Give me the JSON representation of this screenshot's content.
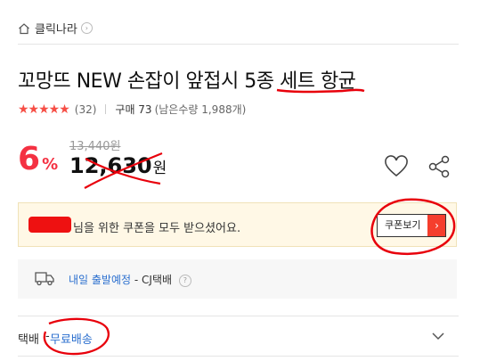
{
  "store": {
    "name": "클릭나라",
    "chevron": "›"
  },
  "product": {
    "title": "꼬망뜨 NEW 손잡이 앞접시 5종 세트 항균",
    "rating": {
      "stars": "★★★★★",
      "count": "(32)"
    },
    "purchase": "구매 73",
    "remaining": "(남은수량 1,988개)"
  },
  "price": {
    "discount_value": "6",
    "discount_unit": "%",
    "original": "13,440원",
    "current": "12,630",
    "currency": "원"
  },
  "coupon": {
    "message": "님을 위한 쿠폰을 모두 받으셨어요.",
    "button_label": "쿠폰보기",
    "button_arrow": "›"
  },
  "delivery": {
    "schedule": "내일 출발예정",
    "carrier": "- CJ택배",
    "help": "?"
  },
  "shipping": {
    "label": "택배",
    "value": "무료배송"
  },
  "colors": {
    "accent": "#f43142",
    "link": "#2b6fcf",
    "annotation": "#e8000b"
  }
}
